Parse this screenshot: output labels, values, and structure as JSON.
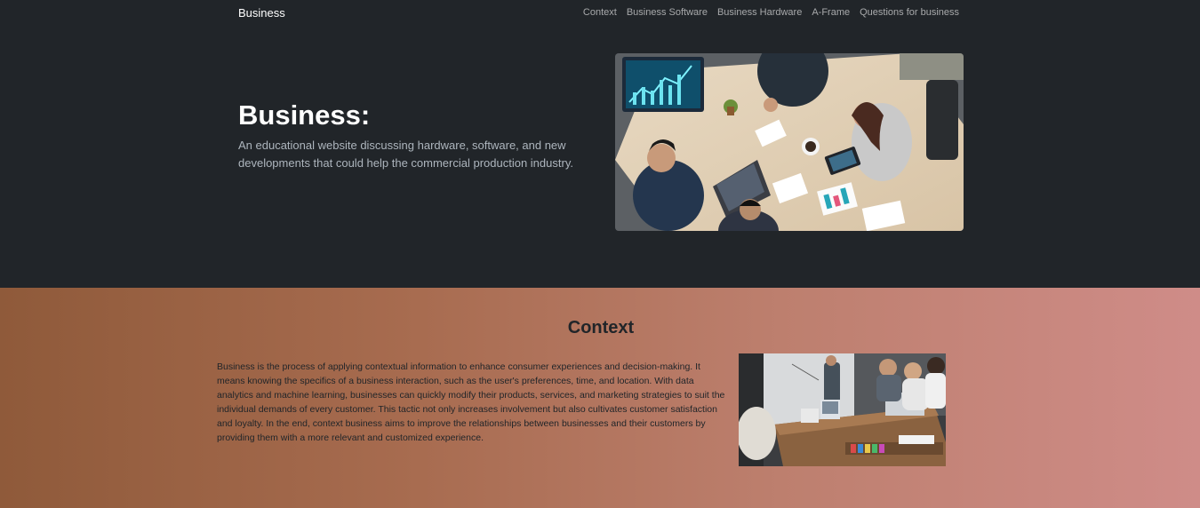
{
  "nav": {
    "brand": "Business",
    "links": [
      "Context",
      "Business Software",
      "Business Hardware",
      "A-Frame",
      "Questions for business"
    ]
  },
  "hero": {
    "title": "Business:",
    "description": "An educational website discussing hardware, software, and new developments that could help the commercial production industry."
  },
  "context": {
    "heading": "Context",
    "body": "Business is the process of applying contextual information to enhance consumer experiences and decision-making. It means knowing the specifics of a business interaction, such as the user's preferences, time, and location. With data analytics and machine learning, businesses can quickly modify their products, services, and marketing strategies to suit the individual demands of every customer. This tactic not only increases involvement but also cultivates customer satisfaction and loyalty. In the end, context business aims to improve the relationships between businesses and their customers by providing them with a more relevant and customized experience."
  },
  "colors": {
    "dark_bg": "#212529",
    "muted_text": "#adb5bd",
    "gradient_start": "#8f5a3a",
    "gradient_end": "#cf8c88"
  }
}
